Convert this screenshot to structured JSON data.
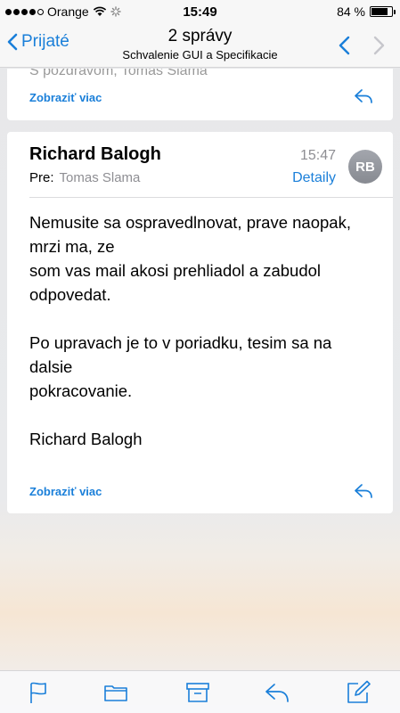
{
  "status_bar": {
    "carrier": "Orange",
    "time": "15:49",
    "battery": "84 %",
    "battery_level": 0.84
  },
  "nav": {
    "back_label": "Prijaté",
    "title": "2 správy",
    "subtitle": "Schvalenie GUI a Specifikacie"
  },
  "prev_message": {
    "clipped_text": "S pozdravom, Tomas Slama",
    "show_more": "Zobraziť viac"
  },
  "message": {
    "sender": "Richard Balogh",
    "to_label": "Pre:",
    "to_name": "Tomas Slama",
    "time": "15:47",
    "details": "Detaily",
    "avatar_initials": "RB",
    "body_lines": [
      "Nemusite sa ospravedlnovat, prave naopak,",
      "mrzi ma, ze",
      "som vas mail akosi prehliadol a zabudol",
      "odpovedat.",
      "Po upravach je to v poriadku, tesim sa na",
      "dalsie",
      "pokracovanie.",
      "Richard Balogh"
    ],
    "show_more": "Zobraziť viac"
  },
  "toolbar": {
    "icons": [
      "flag-icon",
      "folder-icon",
      "archive-icon",
      "reply-icon",
      "compose-icon"
    ]
  },
  "colors": {
    "accent": "#1a7fd9"
  }
}
